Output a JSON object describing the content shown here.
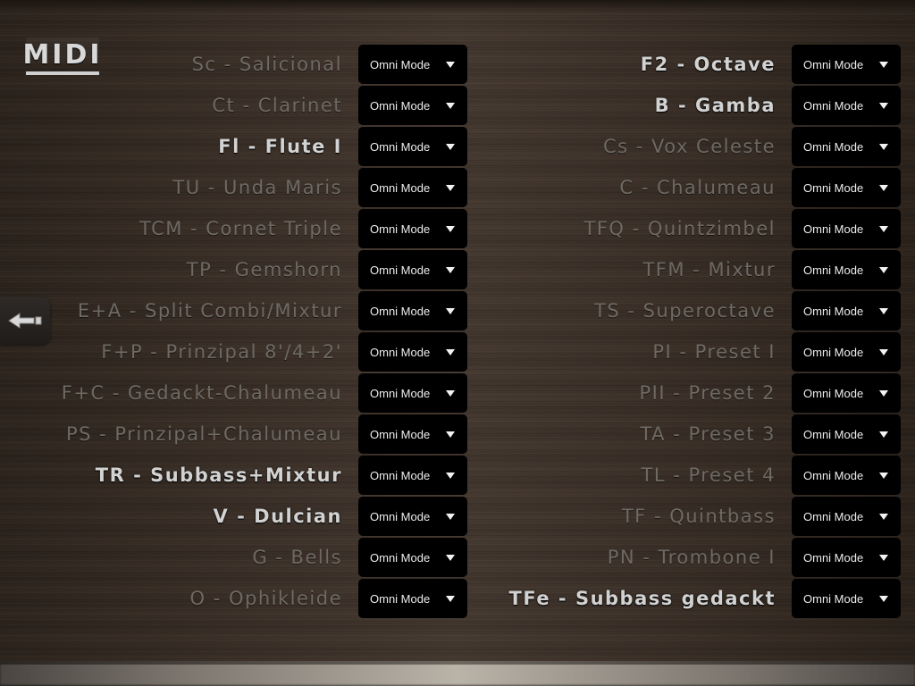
{
  "header": {
    "logo_text": "MIDI"
  },
  "mode_default": "Omni Mode",
  "left_column": [
    {
      "label": "Sc - Salicional",
      "mode": "Omni Mode",
      "active": false
    },
    {
      "label": "Ct - Clarinet",
      "mode": "Omni Mode",
      "active": false
    },
    {
      "label": "Fl - Flute I",
      "mode": "Omni Mode",
      "active": true
    },
    {
      "label": "TU - Unda Maris",
      "mode": "Omni Mode",
      "active": false
    },
    {
      "label": "TCM - Cornet Triple",
      "mode": "Omni Mode",
      "active": false
    },
    {
      "label": "TP - Gemshorn",
      "mode": "Omni Mode",
      "active": false
    },
    {
      "label": "E+A - Split Combi/Mixtur",
      "mode": "Omni Mode",
      "active": false
    },
    {
      "label": "F+P - Prinzipal 8'/4+2'",
      "mode": "Omni Mode",
      "active": false
    },
    {
      "label": "F+C - Gedackt-Chalumeau",
      "mode": "Omni Mode",
      "active": false
    },
    {
      "label": "PS - Prinzipal+Chalumeau",
      "mode": "Omni Mode",
      "active": false
    },
    {
      "label": "TR - Subbass+Mixtur",
      "mode": "Omni Mode",
      "active": true
    },
    {
      "label": "V - Dulcian",
      "mode": "Omni Mode",
      "active": true
    },
    {
      "label": "G - Bells",
      "mode": "Omni Mode",
      "active": false
    },
    {
      "label": "O - Ophikleide",
      "mode": "Omni Mode",
      "active": false
    }
  ],
  "right_column": [
    {
      "label": "F2 - Octave",
      "mode": "Omni Mode",
      "active": true
    },
    {
      "label": "B - Gamba",
      "mode": "Omni Mode",
      "active": true
    },
    {
      "label": "Cs - Vox Celeste",
      "mode": "Omni Mode",
      "active": false
    },
    {
      "label": "C - Chalumeau",
      "mode": "Omni Mode",
      "active": false
    },
    {
      "label": "TFQ - Quintzimbel",
      "mode": "Omni Mode",
      "active": false
    },
    {
      "label": "TFM - Mixtur",
      "mode": "Omni Mode",
      "active": false
    },
    {
      "label": "TS - Superoctave",
      "mode": "Omni Mode",
      "active": false
    },
    {
      "label": "PI - Preset I",
      "mode": "Omni Mode",
      "active": false
    },
    {
      "label": "PII - Preset 2",
      "mode": "Omni Mode",
      "active": false
    },
    {
      "label": "TA - Preset 3",
      "mode": "Omni Mode",
      "active": false
    },
    {
      "label": "TL - Preset 4",
      "mode": "Omni Mode",
      "active": false
    },
    {
      "label": "TF - Quintbass",
      "mode": "Omni Mode",
      "active": false
    },
    {
      "label": "PN - Trombone I",
      "mode": "Omni Mode",
      "active": false
    },
    {
      "label": "TFe - Subbass gedackt",
      "mode": "Omni Mode",
      "active": true
    }
  ],
  "icons": {
    "back": "back-arrow-icon",
    "dropdown": "caret-down-icon"
  },
  "colors": {
    "active_label": "#d2d2d2",
    "inactive_label": "#6f6964",
    "select_bg": "#000000"
  }
}
